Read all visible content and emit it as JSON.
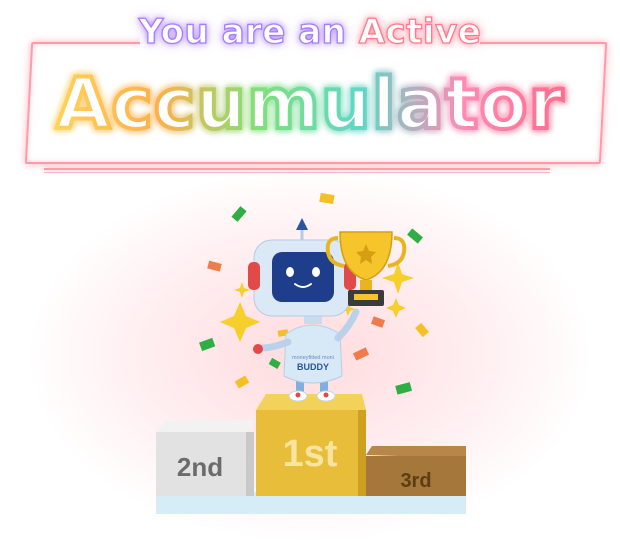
{
  "header": {
    "subtitle_part1": "You are an ",
    "subtitle_part2": "Active",
    "title": "Accumulator"
  },
  "mascot": {
    "shirt_line1": "moneyfitted moni",
    "shirt_line2": "BUDDY"
  },
  "podium": {
    "first_label": "1st",
    "second_label": "2nd",
    "third_label": "3rd"
  },
  "colors": {
    "frame": "#ff9aa8",
    "gold": "#e8bd3a",
    "silver": "#e4e4e4",
    "bronze": "#a6773b",
    "robot_blue": "#1e3e8c"
  },
  "icons": [
    "trophy-icon",
    "sparkle-icon",
    "confetti-icon"
  ]
}
